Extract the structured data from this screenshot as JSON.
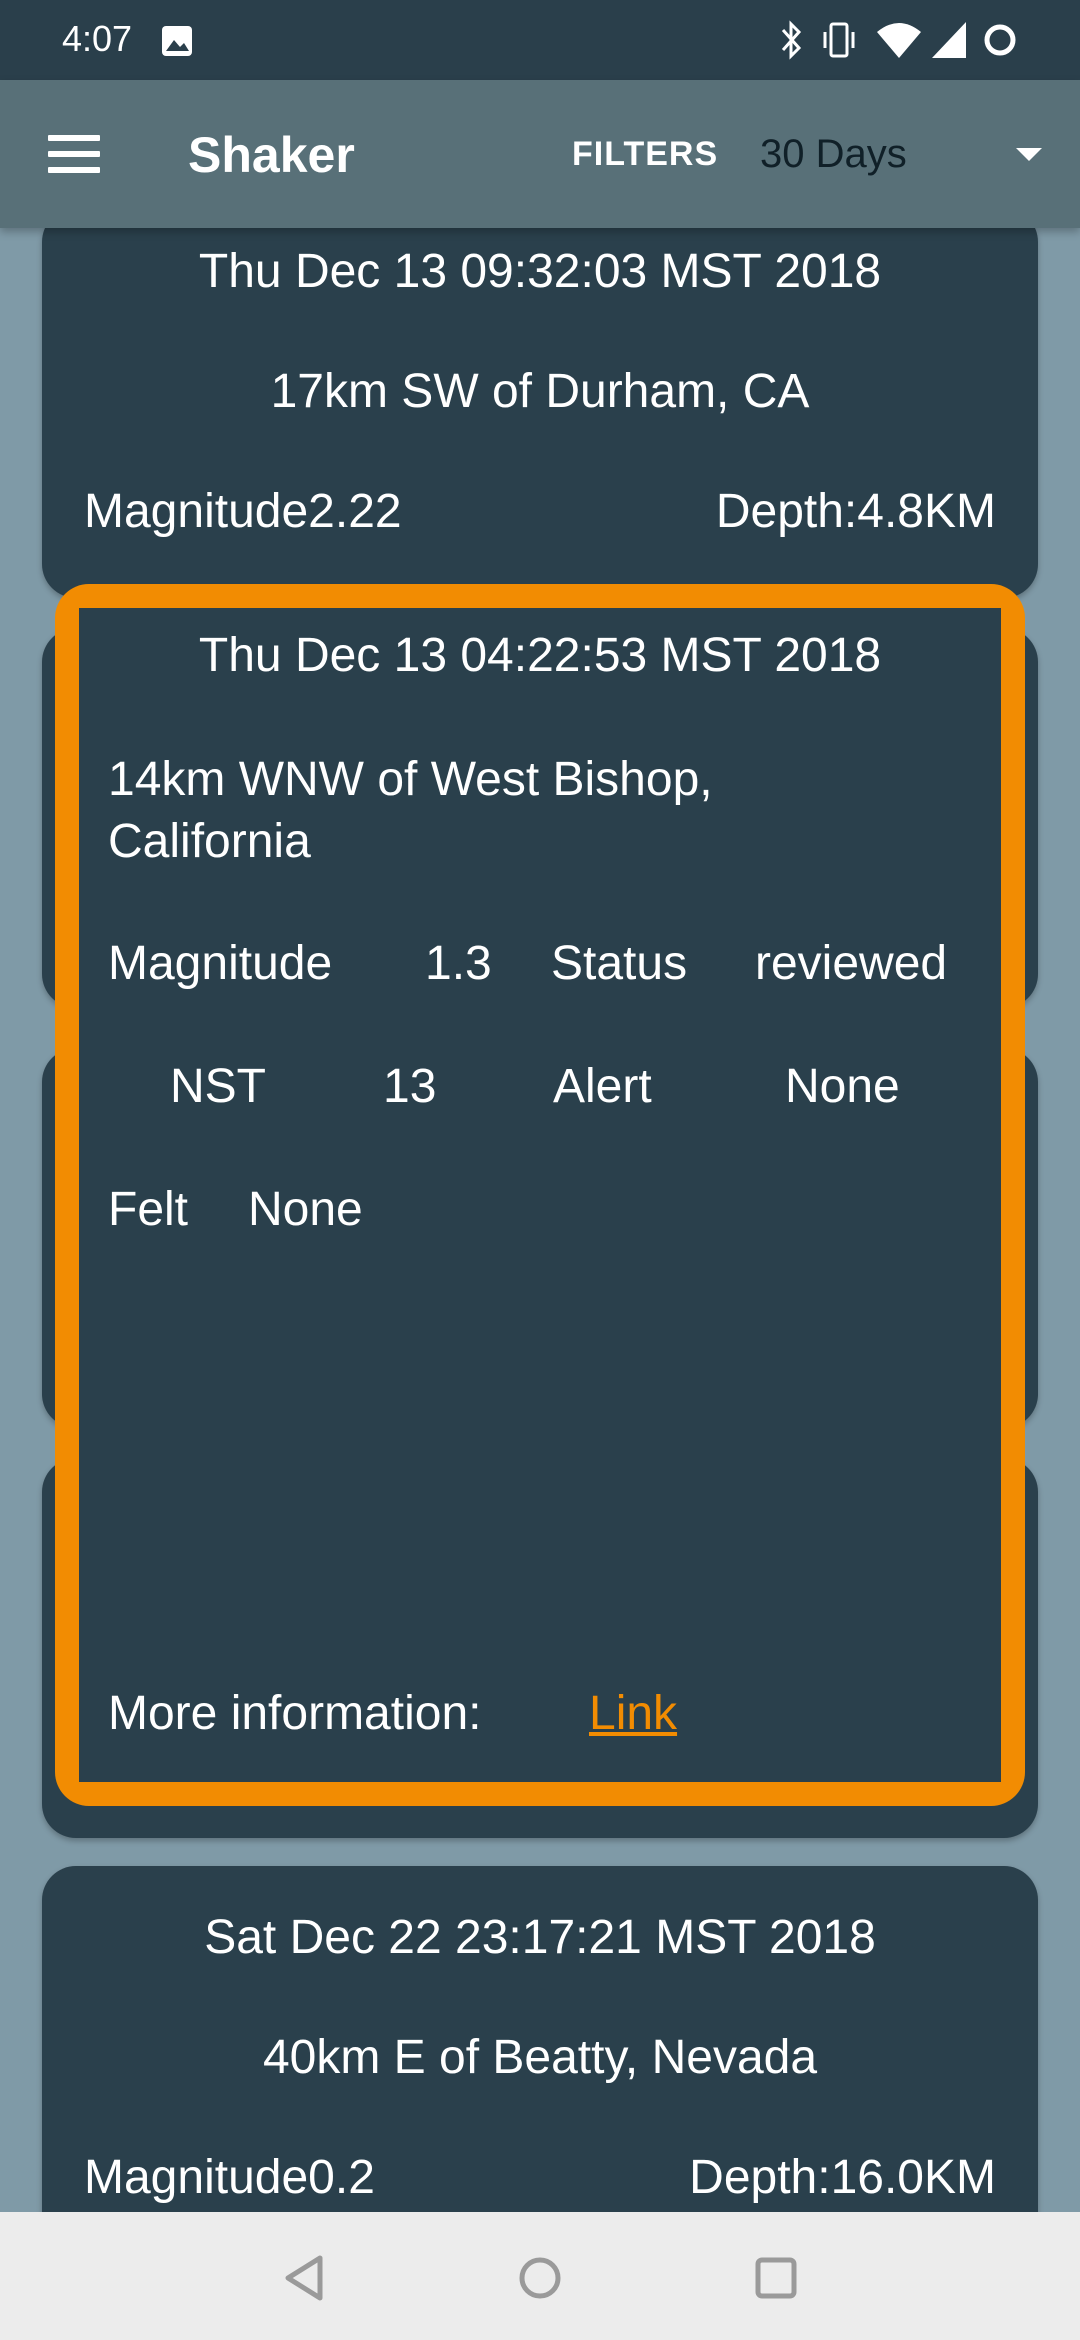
{
  "status_bar": {
    "time": "4:07"
  },
  "app_bar": {
    "title": "Shaker",
    "filters_label": "FILTERS",
    "range_value": "30 Days"
  },
  "cards": [
    {
      "date": "Thu Dec 13 09:32:03 MST 2018",
      "place": "17km SW of Durham, CA",
      "magnitude": "Magnitude2.22",
      "depth": "Depth:4.8KM"
    },
    {
      "date": "Sat Dec 22 23:17:21 MST 2018",
      "place": "40km E of Beatty, Nevada",
      "magnitude": "Magnitude0.2",
      "depth": "Depth:16.0KM"
    }
  ],
  "detail": {
    "date": "Thu Dec 13 04:22:53 MST 2018",
    "place_line1": "14km WNW of West Bishop,",
    "place_line2": "California",
    "magnitude_label": "Magnitude",
    "magnitude_value": "1.3",
    "status_label": "Status",
    "status_value": "reviewed",
    "nst_label": "NST",
    "nst_value": "13",
    "alert_label": "Alert",
    "alert_value": "None",
    "felt_label": "Felt",
    "felt_value": "None",
    "more_info_label": "More information:",
    "link_label": "Link"
  },
  "colors": {
    "accent": "#f28c02",
    "card_bg": "#2a404c",
    "app_bar": "#587078",
    "list_bg": "#7f9aa7"
  }
}
